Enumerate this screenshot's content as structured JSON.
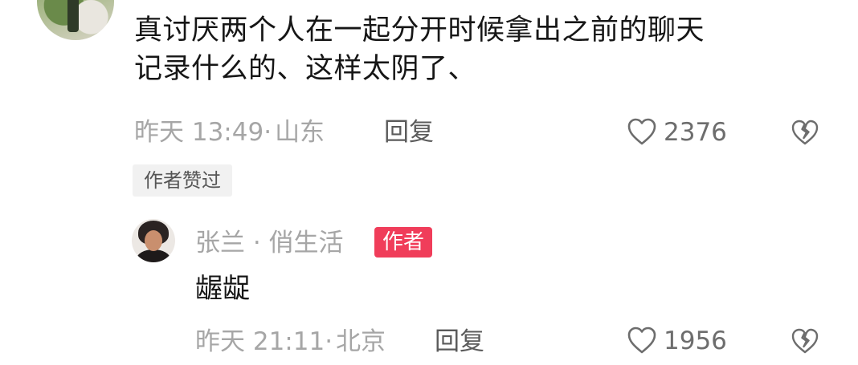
{
  "comment": {
    "text_line1": "真讨厌两个人在一起分开时候拿出之前的聊天",
    "text_line2": "记录什么的、这样太阴了、",
    "time": "昨天 13:49",
    "location_sep": "·",
    "location": "山东",
    "reply_label": "回复",
    "like_count": "2376",
    "liked_by_author_badge": "作者赞过"
  },
  "reply": {
    "author_name": "张兰 · 俏生活",
    "author_badge": "作者",
    "text": "龌龊",
    "time": "昨天 21:11",
    "location_sep": "·",
    "location": "北京",
    "reply_label": "回复",
    "like_count": "1956"
  },
  "icons": {
    "like": "heart-outline-icon",
    "dislike": "broken-heart-icon"
  },
  "colors": {
    "author_badge_bg": "#f03d5a",
    "meta_text": "#a6a6a6",
    "main_text": "#161616"
  }
}
